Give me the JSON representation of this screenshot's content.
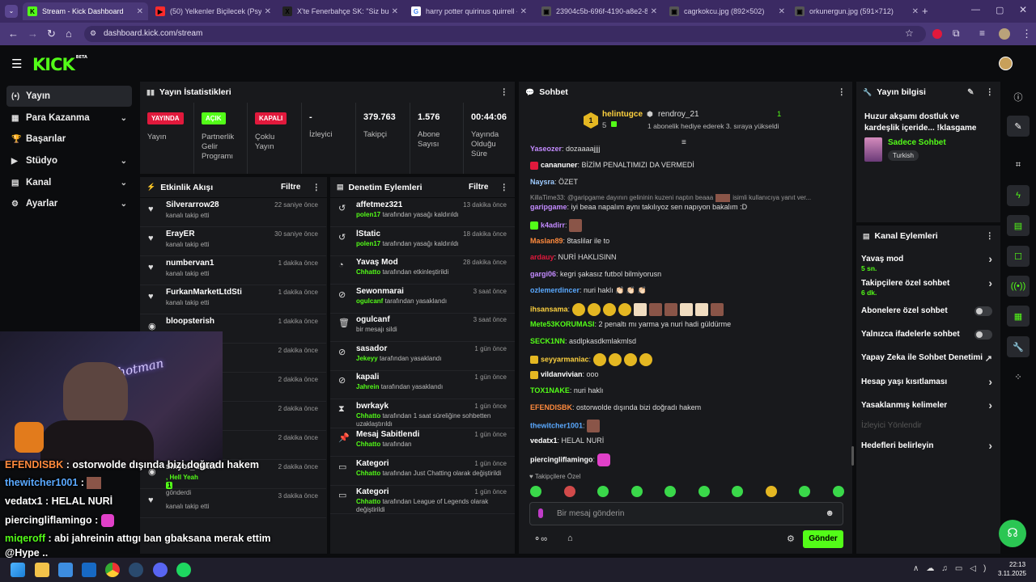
{
  "browser": {
    "tabs": [
      {
        "title": "Stream - Kick Dashboard",
        "icon": "K",
        "color": "#53fc18"
      },
      {
        "title": "(50) Yelkenler Biçilecek (Psytran",
        "icon": "▶",
        "color": "#ff2b2b"
      },
      {
        "title": "X'te Fenerbahçe SK: \"Siz bunun",
        "icon": "X",
        "color": "#222"
      },
      {
        "title": "harry potter quirinus quirrell - G",
        "icon": "G",
        "color": "#ffffff"
      },
      {
        "title": "23904c5b-696f-4190-a8e2-8cb",
        "icon": "▣",
        "color": "#555"
      },
      {
        "title": "cagrkokcu.jpg (892×502)",
        "icon": "▣",
        "color": "#555"
      },
      {
        "title": "orkunergun.jpg (591×712)",
        "icon": "▣",
        "color": "#555"
      }
    ],
    "url": "dashboard.kick.com/stream"
  },
  "brand": {
    "logo": "KICK",
    "beta": "BETA"
  },
  "nav": [
    {
      "label": "Yayın",
      "icon": "(•)",
      "active": true
    },
    {
      "label": "Para Kazanma",
      "icon": "▦",
      "chevron": true
    },
    {
      "label": "Başarılar",
      "icon": "🏆",
      "chevron": false
    },
    {
      "label": "Stüdyo",
      "icon": "▶",
      "chevron": true
    },
    {
      "label": "Kanal",
      "icon": "▤",
      "chevron": true
    },
    {
      "label": "Ayarlar",
      "icon": "⚙",
      "chevron": true
    }
  ],
  "stats": {
    "title": "Yayın İstatistikleri",
    "cols": [
      {
        "badge": "YAYINDA",
        "badge_color": "#e1193c",
        "label": "Yayın"
      },
      {
        "badge": "AÇIK",
        "badge_color": "#53fc18",
        "label": "Partnerlik Gelir Programı"
      },
      {
        "badge": "KAPALI",
        "badge_color": "#e1193c",
        "label": "Çoklu Yayın"
      },
      {
        "value": "-",
        "label": "İzleyici"
      },
      {
        "value": "379.763",
        "label": "Takipçi"
      },
      {
        "value": "1.576",
        "label": "Abone Sayısı"
      },
      {
        "value": "00:44:06",
        "label": "Yayında Olduğu Süre"
      }
    ]
  },
  "activity": {
    "title": "Etkinlik Akışı",
    "filter": "Filtre",
    "items": [
      {
        "name": "Silverarrow28",
        "sub": "kanalı takip etti",
        "time": "22 saniye önce"
      },
      {
        "name": "ErayER",
        "sub": "kanalı takip etti",
        "time": "30 saniye önce"
      },
      {
        "name": "numbervan1",
        "sub": "kanalı takip etti",
        "time": "1 dakika önce"
      },
      {
        "name": "FurkanMarketLtdSti",
        "sub": "kanalı takip etti",
        "time": "1 dakika önce"
      },
      {
        "name": "bloopsterish",
        "sub": "",
        "time": "1 dakika önce"
      },
      {
        "name": "",
        "sub": "",
        "time": "2 dakika önce"
      },
      {
        "name": "",
        "sub": "",
        "time": "2 dakika önce"
      },
      {
        "name": "",
        "sub": "",
        "time": "2 dakika önce"
      },
      {
        "name": "ozgp",
        "sub": "kanalı takip etti",
        "time": "2 dakika önce"
      },
      {
        "name": "sinyor_dante",
        "sub": ", Hell Yeah",
        "extra": "1",
        "sub2": "gönderdi",
        "time": "2 dakika önce"
      },
      {
        "name": "",
        "sub": "kanalı takip etti",
        "time": "3 dakika önce"
      }
    ]
  },
  "moderation": {
    "title": "Denetim Eylemleri",
    "filter": "Filtre",
    "items": [
      {
        "name": "affetmez321",
        "icon": "↺",
        "mod": "polen17",
        "sub": "tarafından yasağı kaldırıldı",
        "time": "13 dakika önce"
      },
      {
        "name": "lStatic",
        "icon": "↺",
        "mod": "polen17",
        "sub": "tarafından yasağı kaldırıldı",
        "time": "18 dakika önce"
      },
      {
        "name": "Yavaş Mod",
        "icon": "◔",
        "mod": "Chhatto",
        "sub": "tarafından etkinleştirildi",
        "time": "28 dakika önce"
      },
      {
        "name": "Sewonmarai",
        "icon": "⊘",
        "mod": "ogulcanf",
        "sub": "tarafından yasaklandı",
        "time": "3 saat önce"
      },
      {
        "name": "ogulcanf",
        "icon": "🗑",
        "mod": "",
        "sub": "bir mesajı sildi",
        "time": "3 saat önce"
      },
      {
        "name": "sasador",
        "icon": "⊘",
        "mod": "Jekeyy",
        "sub": "tarafından yasaklandı",
        "time": "1 gün önce"
      },
      {
        "name": "kapali",
        "icon": "⊘",
        "mod": "Jahrein",
        "sub": "tarafından yasaklandı",
        "time": "1 gün önce"
      },
      {
        "name": "bwrkayk",
        "icon": "⧗",
        "mod": "Chhatto",
        "sub": "tarafından 1 saat süreliğine sohbetten uzaklaştırıldı",
        "time": "1 gün önce"
      },
      {
        "name": "Mesaj Sabitlendi",
        "icon": "📌",
        "mod": "Chhatto",
        "sub": "tarafından",
        "time": "1 gün önce"
      },
      {
        "name": "Kategori",
        "icon": "▭",
        "mod": "Chhatto",
        "sub": "tarafından Just Chatting olarak değiştirildi",
        "time": "1 gün önce"
      },
      {
        "name": "Kategori",
        "icon": "▭",
        "mod": "Chhatto",
        "sub": "tarafından League of Legends olarak değiştirildi",
        "time": "1 gün önce"
      }
    ]
  },
  "chat": {
    "title": "Sohbet",
    "pinned": {
      "rank": "1",
      "user": "helintugce",
      "count": "5",
      "gifter": "rendroy_21",
      "gift_count": "1",
      "message": "1 abonelik hediye ederek 3. sıraya yükseldi"
    },
    "reply_banner": "KillaTime33: @garipgame dayının gelininin kuzeni naptın beaaa",
    "reply_tail": "isimli kullanıcıya yanıt ver...",
    "lines": [
      {
        "user": "Yaseozer",
        "color": "#c38bff",
        "text": "dozaaaajjjj"
      },
      {
        "user": "cananuner",
        "color": "#ffffff",
        "text": "BİZİM PENALTIMIZI DA VERMEDİ",
        "badge": "#e1193c"
      },
      {
        "user": "Naysra",
        "color": "#9ecbff",
        "text": "ÖZET"
      },
      {
        "user": "garipgame",
        "color": "#c38bff",
        "text": "iyi beaa napalım aynı takılıyoz sen napıyon bakalım :D"
      },
      {
        "user": "k4adirr",
        "color": "#c38bff",
        "text": "",
        "emotes": 1,
        "badge": "#53fc18"
      },
      {
        "user": "Maslan89",
        "color": "#ff8a3d",
        "text": "8taslilar ile to"
      },
      {
        "user": "ardauy",
        "color": "#e1193c",
        "text": "NURİ HAKLISINN"
      },
      {
        "user": "gargi06",
        "color": "#c38bff",
        "text": "kegri şakasız futbol bilmiyorusn"
      },
      {
        "user": "ozlemerdincer",
        "color": "#5aa9ff",
        "text": "nuri haklı 👏🏻 👏🏻 👏🏻"
      },
      {
        "user": "ihsansama",
        "color": "#ffd23f",
        "text": "",
        "emotes": 10
      },
      {
        "user": "Mete53KORUMASI",
        "color": "#53fc18",
        "text": "2 penaltı mı yarma ya nuri hadi güldürme"
      },
      {
        "user": "SECK1NN",
        "color": "#53fc18",
        "text": "asdlpkasdkmlakmlsd"
      },
      {
        "user": "seyyarmaniac",
        "color": "#ffd23f",
        "text": "",
        "emotes": 4,
        "badge": "#e4b722"
      },
      {
        "user": "vildanvivian",
        "color": "#ffffff",
        "text": "ooo",
        "badge": "#e4b722"
      },
      {
        "user": "TOX1NAKE",
        "color": "#53fc18",
        "text": "nuri haklı"
      },
      {
        "user": "EFENDISBK",
        "color": "#ff8a3d",
        "text": "ostorwolde dışında bizi doğradı hakem"
      },
      {
        "user": "thewitcher1001",
        "color": "#5aa9ff",
        "text": "",
        "emotes": 1
      },
      {
        "user": "vedatx1",
        "color": "#ffffff",
        "text": "HELAL NURİ"
      },
      {
        "user": "piercingliflamingo",
        "color": "#ffffff",
        "text": "",
        "emotes": 1
      }
    ],
    "followers_only": "Takipçilere Özel",
    "input_placeholder": "Bir mesaj gönderin",
    "send": "Gönder"
  },
  "info": {
    "title": "Yayın bilgisi",
    "stream_title": "Huzur akşamı dostluk ve kardeşlik içeride... !klasgame",
    "category": "Sadece Sohbet",
    "language": "Turkish"
  },
  "channel_actions": {
    "title": "Kanal Eylemleri",
    "items": [
      {
        "label": "Yavaş mod",
        "sub": "5 sn.",
        "kind": "chev"
      },
      {
        "label": "Takipçilere özel sohbet",
        "sub": "6 dk.",
        "kind": "chev"
      },
      {
        "label": "Abonelere özel sohbet",
        "kind": "toggle"
      },
      {
        "label": "Yalnızca ifadelerle sohbet",
        "kind": "toggle"
      },
      {
        "label": "Yapay Zeka ile Sohbet Denetimi",
        "kind": "ext"
      },
      {
        "label": "Hesap yaşı kısıtlaması",
        "kind": "chev"
      },
      {
        "label": "Yasaklanmış kelimeler",
        "kind": "chev"
      },
      {
        "label": "İzleyici Yönlendir",
        "kind": "disabled"
      },
      {
        "label": "Hedefleri belirleyin",
        "kind": "chev"
      }
    ]
  },
  "overlay": {
    "cam_text": "hotman",
    "lines": [
      {
        "user": "EFENDISBK",
        "color": "#ff8a3d",
        "text": " : ostorwolde dışında bizi doğradı hakem"
      },
      {
        "user": "thewitcher1001",
        "color": "#5aa9ff",
        "text": " : "
      },
      {
        "user": "vedatx1",
        "color": "#ffffff",
        "text": " : HELAL NURİ"
      },
      {
        "user": "piercingliflamingo",
        "color": "#ffffff",
        "text": " : "
      },
      {
        "user": "miqeroff",
        "color": "#53fc18",
        "text": " : abi jahreinin attıgı ban gbaksana merak ettim"
      },
      {
        "user": "",
        "color": "#ffffff",
        "text": "@Hype .."
      }
    ]
  },
  "taskbar": {
    "time": "22:13",
    "date": "3.11.2025"
  }
}
